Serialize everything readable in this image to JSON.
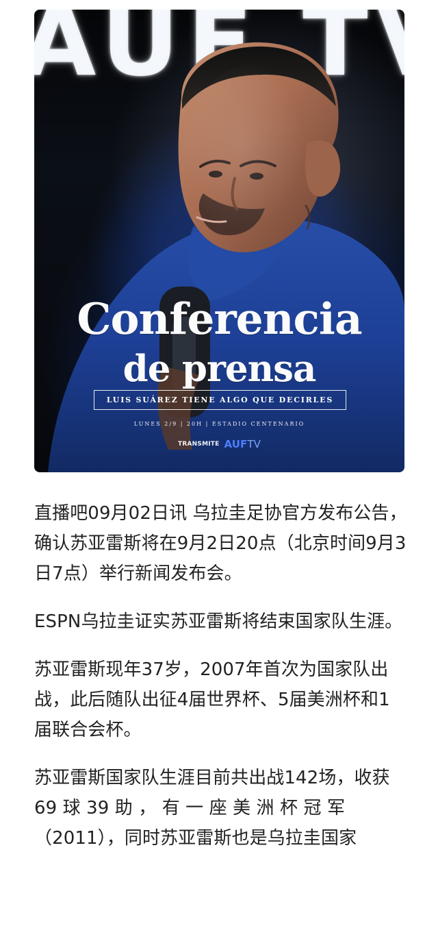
{
  "poster": {
    "background_logo_text": "AUF TV",
    "title_line_1": "Conferencia",
    "title_line_2": "de prensa",
    "tagline": "LUIS SUÁREZ TIENE ALGO QUE DECIRLES",
    "event_details": "LUNES 2/9 | 20H | ESTADIO CENTENARIO",
    "transmission_label": "TRANSMITE",
    "transmission_brand_auf": "AUF",
    "transmission_brand_tv": "TV",
    "colors": {
      "background": "#06080c",
      "jersey": "#1d3f95",
      "text": "#ffffff",
      "brand_blue": "#4d7dff"
    }
  },
  "article": {
    "paragraphs": [
      "直播吧09月02日讯 乌拉圭足协官方发布公告，确认苏亚雷斯将在9月2日20点（北京时间9月3日7点）举行新闻发布会。",
      "ESPN乌拉圭证实苏亚雷斯将结束国家队生涯。",
      "苏亚雷斯现年37岁，2007年首次为国家队出战，此后随队出征4届世界杯、5届美洲杯和1届联合会杯。",
      "苏亚雷斯国家队生涯目前共出战142场，收获 69 球 39 助 ， 有 一 座 美 洲 杯 冠 军（2011），同时苏亚雷斯也是乌拉圭国家"
    ]
  }
}
